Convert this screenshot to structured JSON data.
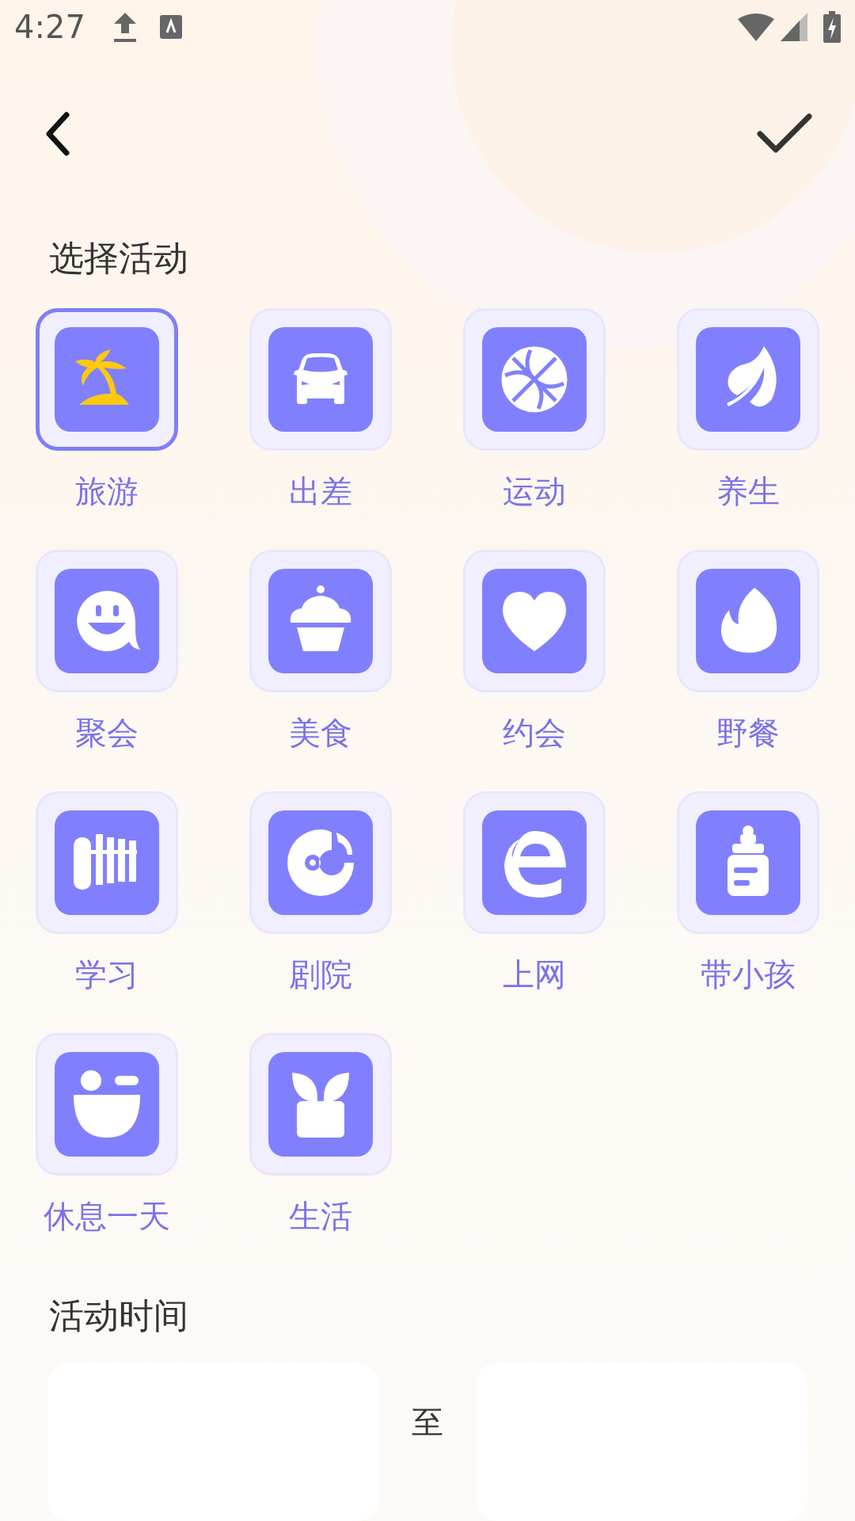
{
  "status_bar": {
    "time": "4:27"
  },
  "section_title": "选择活动",
  "activities": [
    {
      "label": "旅游",
      "selected": true
    },
    {
      "label": "出差",
      "selected": false
    },
    {
      "label": "运动",
      "selected": false
    },
    {
      "label": "养生",
      "selected": false
    },
    {
      "label": "聚会",
      "selected": false
    },
    {
      "label": "美食",
      "selected": false
    },
    {
      "label": "约会",
      "selected": false
    },
    {
      "label": "野餐",
      "selected": false
    },
    {
      "label": "学习",
      "selected": false
    },
    {
      "label": "剧院",
      "selected": false
    },
    {
      "label": "上网",
      "selected": false
    },
    {
      "label": "带小孩",
      "selected": false
    },
    {
      "label": "休息一天",
      "selected": false
    },
    {
      "label": "生活",
      "selected": false
    }
  ],
  "time_section": {
    "title": "活动时间",
    "separator": "至"
  }
}
